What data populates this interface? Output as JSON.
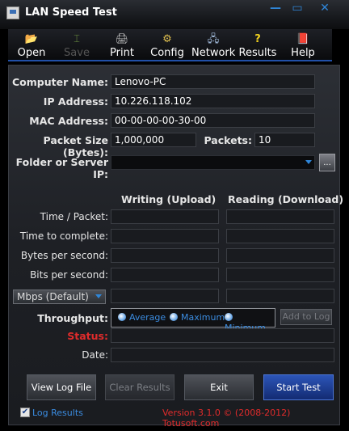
{
  "window": {
    "title": "LAN Speed Test",
    "minimize_glyph": "—",
    "maximize_glyph": "▭",
    "close_glyph": "✕"
  },
  "toolbar": {
    "items": [
      {
        "label": "Open",
        "icon": "folder-icon",
        "glyph": "📂",
        "enabled": true
      },
      {
        "label": "Save",
        "icon": "save-icon",
        "glyph": "⌶",
        "enabled": false
      },
      {
        "label": "Print",
        "icon": "printer-icon",
        "glyph": "🖨",
        "enabled": true
      },
      {
        "label": "Config",
        "icon": "config-icon",
        "glyph": "⚙",
        "enabled": true
      },
      {
        "label": "Network",
        "icon": "network-icon",
        "glyph": "🖧",
        "enabled": true
      },
      {
        "label": "Results",
        "icon": "question-icon",
        "glyph": "?",
        "enabled": true
      },
      {
        "label": "Help",
        "icon": "help-book-icon",
        "glyph": "📕",
        "enabled": true
      }
    ]
  },
  "form": {
    "computer_name_label": "Computer Name:",
    "computer_name_value": "Lenovo-PC",
    "ip_label": "IP Address:",
    "ip_value": "10.226.118.102",
    "mac_label": "MAC Address:",
    "mac_value": "00-00-00-00-30-00",
    "packet_size_label": "Packet Size (Bytes):",
    "packet_size_value": "1,000,000",
    "packets_label": "Packets:",
    "packets_value": "10",
    "folder_label": "Folder or Server IP:",
    "folder_value": "",
    "browse_label": "..."
  },
  "results": {
    "writing_header": "Writing (Upload)",
    "reading_header": "Reading (Download)",
    "row_labels": [
      "Time / Packet:",
      "Time to complete:",
      "Bytes per second:",
      "Bits per second:"
    ],
    "units_selected": "Mbps (Default)",
    "throughput_label": "Throughput:",
    "radio_options": [
      "Average",
      "Maximum",
      "Minimum"
    ],
    "radio_selected": "Average",
    "add_to_log_label": "Add to Log",
    "status_label": "Status:",
    "date_label": "Date:"
  },
  "buttons": {
    "view_log": "View Log File",
    "clear_results": "Clear Results",
    "exit": "Exit",
    "start_test": "Start Test"
  },
  "footer": {
    "log_results_label": "Log Results",
    "log_results_checked": true,
    "version": "Version 3.1.0  © (2008-2012) Totusoft.com"
  },
  "colors": {
    "accent_blue": "#2f86d8",
    "status_red": "#e02b2b"
  }
}
